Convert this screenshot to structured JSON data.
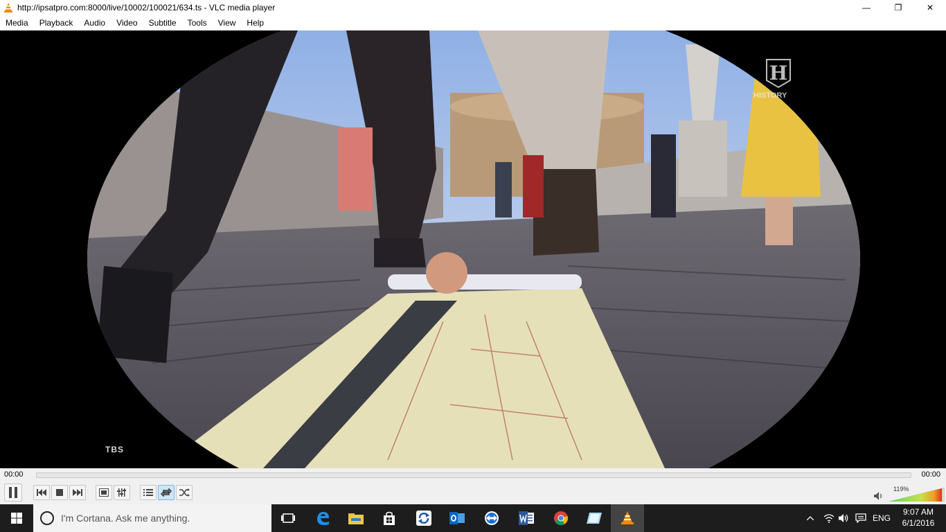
{
  "window": {
    "title": "http://ipsatpro.com:8000/live/10002/100021/634.ts - VLC media player",
    "minimize": "—",
    "maximize": "❐",
    "close": "✕"
  },
  "menu": [
    "Media",
    "Playback",
    "Audio",
    "Video",
    "Subtitle",
    "Tools",
    "View",
    "Help"
  ],
  "video": {
    "watermark_left": "TBS",
    "watermark_right": "HISTORY",
    "logo_letter": "H"
  },
  "playback": {
    "elapsed": "00:00",
    "remaining": "00:00",
    "progress": 0
  },
  "volume": {
    "percent_label": "119%",
    "level": 1.19
  },
  "taskbar": {
    "search_placeholder": "I'm Cortana. Ask me anything.",
    "language": "ENG",
    "time": "9:07 AM",
    "date": "6/1/2016"
  },
  "colors": {
    "accent": "#0078d7",
    "vlc_orange": "#f28a00",
    "taskbar": "#1d1d1d"
  }
}
